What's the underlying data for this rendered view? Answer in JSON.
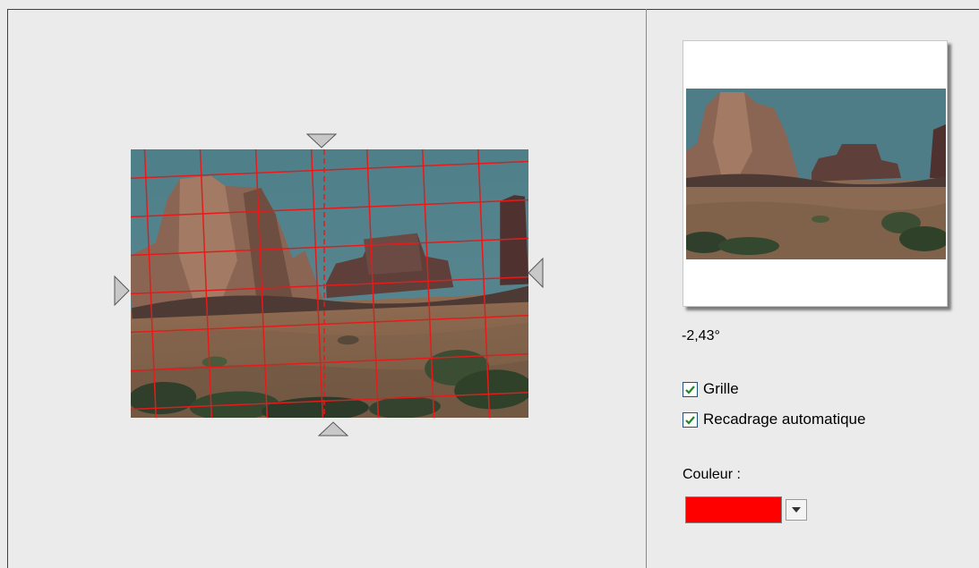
{
  "editor": {
    "rotation_angle_deg": -2.43,
    "grid_color": "#e51b1b"
  },
  "preview": {
    "angle_text": "-2,43°"
  },
  "options": {
    "grid_label": "Grille",
    "grid_checked": true,
    "autocrop_label": "Recadrage automatique",
    "autocrop_checked": true
  },
  "color": {
    "label": "Couleur :",
    "selected_value": "#ff0000"
  },
  "icons": {
    "top_handle": "triangle-down-icon",
    "bottom_handle": "triangle-up-icon",
    "left_handle": "triangle-right-icon",
    "right_handle": "triangle-left-icon",
    "checkbox_check": "checkmark-icon",
    "dropdown": "chevron-down-icon"
  }
}
